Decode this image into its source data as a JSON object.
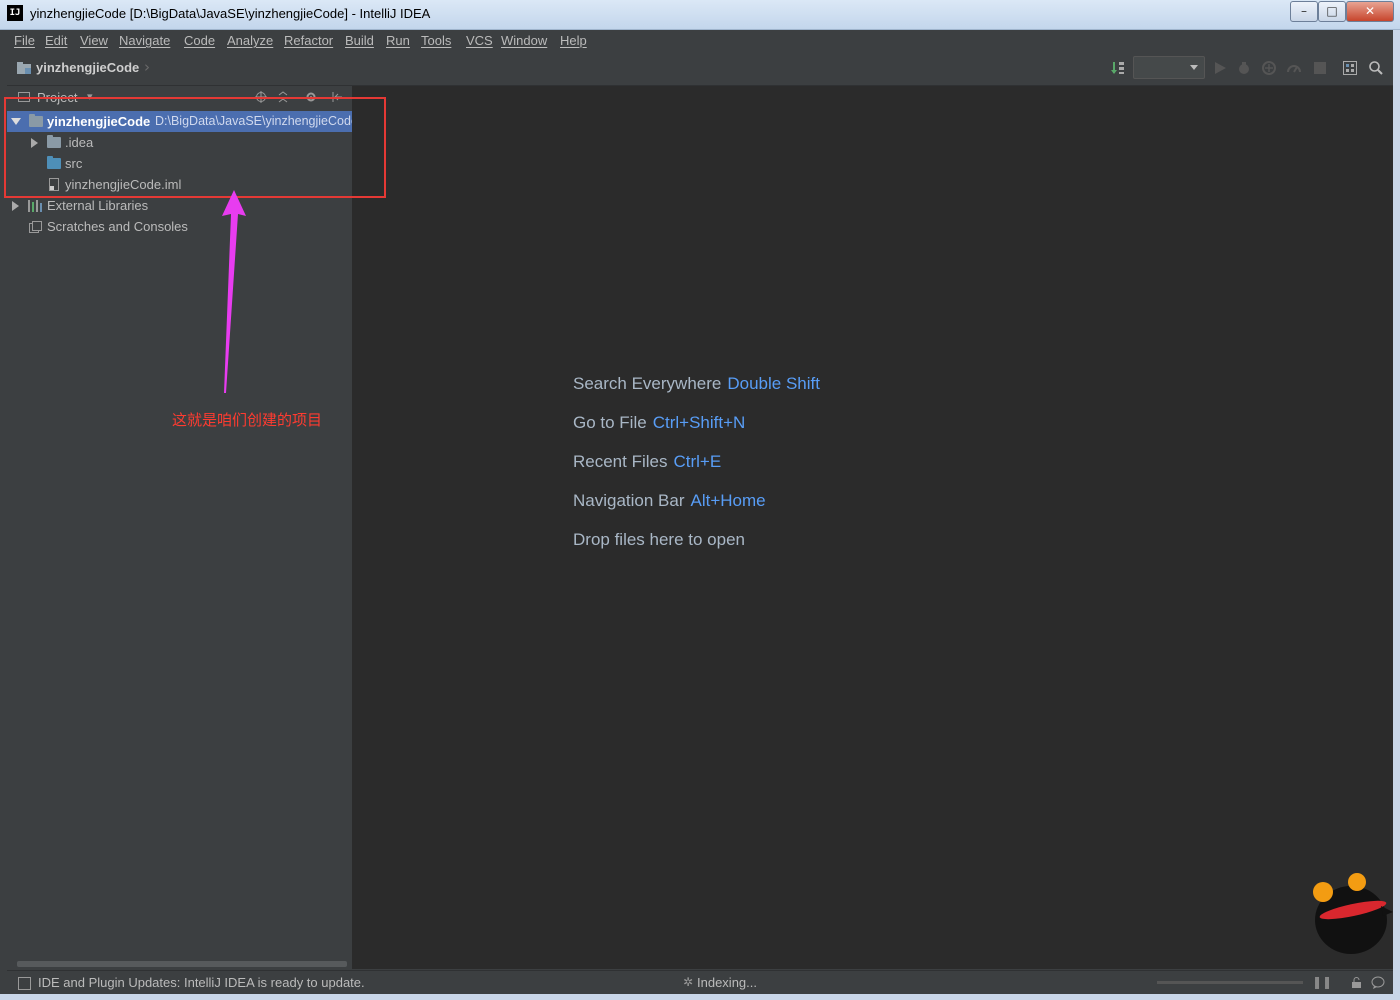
{
  "window": {
    "title": "yinzhengjieCode [D:\\BigData\\JavaSE\\yinzhengjieCode] - IntelliJ IDEA",
    "app_icon_label": "IJ",
    "controls": {
      "minimize": "–",
      "maximize": "□",
      "close": "✕"
    }
  },
  "menu": [
    {
      "label": "File"
    },
    {
      "label": "Edit"
    },
    {
      "label": "View"
    },
    {
      "label": "Navigate"
    },
    {
      "label": "Code"
    },
    {
      "label": "Analyze"
    },
    {
      "label": "Refactor"
    },
    {
      "label": "Build"
    },
    {
      "label": "Run"
    },
    {
      "label": "Tools"
    },
    {
      "label": "VCS"
    },
    {
      "label": "Window"
    },
    {
      "label": "Help"
    }
  ],
  "navbar": {
    "project_name": "yinzhengjieCode"
  },
  "project_panel": {
    "title": "Project",
    "tree": {
      "root_name": "yinzhengjieCode",
      "root_path": "D:\\BigData\\JavaSE\\yinzhengjieCode",
      "children": [
        {
          "label": ".idea"
        },
        {
          "label": "src"
        },
        {
          "label": "yinzhengjieCode.iml"
        }
      ],
      "external_libraries": "External Libraries",
      "scratches": "Scratches and Consoles"
    }
  },
  "editor_hints": [
    {
      "text": "Search Everywhere",
      "shortcut": "Double Shift"
    },
    {
      "text": "Go to File",
      "shortcut": "Ctrl+Shift+N"
    },
    {
      "text": "Recent Files",
      "shortcut": "Ctrl+E"
    },
    {
      "text": "Navigation Bar",
      "shortcut": "Alt+Home"
    },
    {
      "text": "Drop files here to open",
      "shortcut": ""
    }
  ],
  "status": {
    "message": "IDE and Plugin Updates: IntelliJ IDEA is ready to update.",
    "indexing": "Indexing...",
    "progress": 0.0
  },
  "annotation": {
    "text": "这就是咱们创建的项目",
    "color": "#e53935",
    "arrow_color": "#e83cf0"
  },
  "colors": {
    "selection": "#4b6eaf",
    "shortcut": "#589df6",
    "editor_bg": "#2b2b2b",
    "panel_bg": "#3c3f41"
  }
}
